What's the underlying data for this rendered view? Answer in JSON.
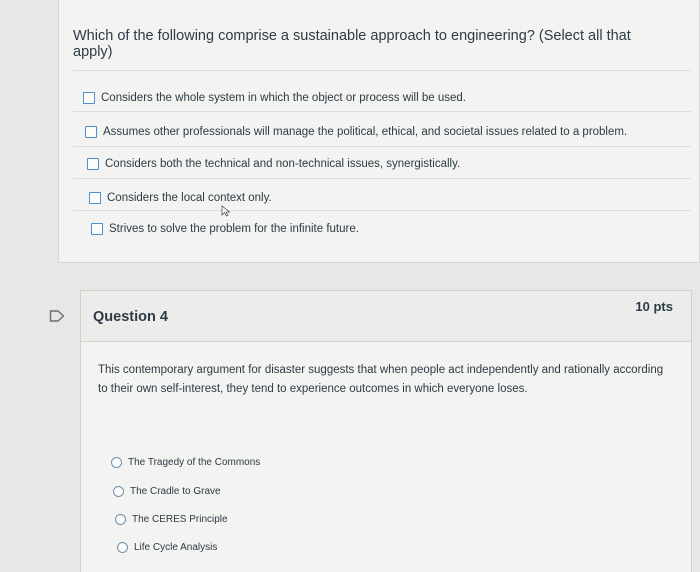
{
  "question3": {
    "prompt": "Which of the following comprise a sustainable approach to engineering? (Select all that apply)",
    "options": [
      "Considers the whole system in which the object or process will be used.",
      "Assumes other professionals will manage the political, ethical, and societal issues related to a problem.",
      "Considers both the technical and non-technical issues, synergistically.",
      "Considers the local context only.",
      "Strives to solve the problem for the infinite future."
    ]
  },
  "question4": {
    "title": "Question 4",
    "points": "10 pts",
    "prompt": "This contemporary argument for disaster suggests that when people act independently and rationally according to their own self-interest, they tend to experience outcomes in which everyone loses.",
    "options": [
      "The Tragedy of the Commons",
      "The Cradle to Grave",
      "The CERES Principle",
      "Life Cycle Analysis"
    ]
  },
  "colors": {
    "checkbox_border": "#4f8fc9",
    "text": "#2d3b45"
  }
}
